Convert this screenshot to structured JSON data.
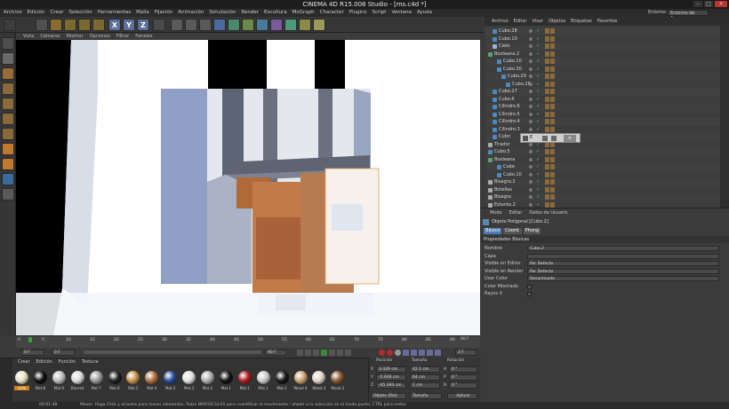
{
  "window": {
    "title": "CINEMA 4D R15.008 Studio - [ms.c4d *]",
    "layout_label": "Entorno:",
    "layout_value": "Entorno de Arranque"
  },
  "menu": [
    "Archivo",
    "Edición",
    "Crear",
    "Selección",
    "Herramientas",
    "Malla",
    "Fijación",
    "Animación",
    "Simulación",
    "Render",
    "Escultura",
    "MoGraph",
    "Character",
    "Plugins",
    "Script",
    "Ventana",
    "Ayuda"
  ],
  "toolbar": {
    "x": "X",
    "y": "Y",
    "z": "Z"
  },
  "viewport_menu": [
    "Vista",
    "Cámaras",
    "Mostrar",
    "Opciones",
    "Filtrar",
    "Paneles"
  ],
  "object_manager": {
    "menu": [
      "Archivo",
      "Editar",
      "Visor",
      "Objetos",
      "Etiquetas",
      "Favoritos"
    ],
    "rows": [
      {
        "name": "Cubo.28",
        "indent": 1
      },
      {
        "name": "Cubo.10",
        "indent": 1
      },
      {
        "name": "Cielo",
        "indent": 1
      },
      {
        "name": "Booleana.2",
        "indent": 0
      },
      {
        "name": "Cubo.10",
        "indent": 2
      },
      {
        "name": "Cubo.30",
        "indent": 2
      },
      {
        "name": "Cubo.29",
        "indent": 3
      },
      {
        "name": "Cubo.28",
        "indent": 4
      },
      {
        "name": "Cubo.27",
        "indent": 1
      },
      {
        "name": "Cubo.6",
        "indent": 1
      },
      {
        "name": "Cilindro.6",
        "indent": 1
      },
      {
        "name": "Cilindro.5",
        "indent": 1
      },
      {
        "name": "Cilindro.4",
        "indent": 1
      },
      {
        "name": "Cilindro.3",
        "indent": 1
      },
      {
        "name": "Cubo",
        "indent": 1
      },
      {
        "name": "Tirador",
        "indent": 0
      },
      {
        "name": "Cubo.5",
        "indent": 0
      },
      {
        "name": "Booleana",
        "indent": 0
      },
      {
        "name": "Cube",
        "indent": 2
      },
      {
        "name": "Cubo.10",
        "indent": 2
      },
      {
        "name": "Bisagra.2",
        "indent": 0
      },
      {
        "name": "Botellas",
        "indent": 0
      },
      {
        "name": "Bisagra",
        "indent": 0
      },
      {
        "name": "Estante.2",
        "indent": 0
      }
    ],
    "popup_label": "E"
  },
  "attributes": {
    "menu": [
      "Modo",
      "Editar",
      "Datos de Usuario"
    ],
    "object_title": "Objeto Poligonal [Cubo.2]",
    "tabs": [
      "Básico",
      "Coord.",
      "Phong"
    ],
    "section": "Propiedades Básicas",
    "rows": [
      {
        "label": "Nombre",
        "value": "Cubo.2"
      },
      {
        "label": "Capa",
        "value": ""
      },
      {
        "label": "Visible en Editor",
        "value": "Por Defecto"
      },
      {
        "label": "Visible en Render",
        "value": "Por Defecto"
      },
      {
        "label": "Usar Color",
        "value": "Desactivado"
      },
      {
        "label": "Color Mostrado",
        "value": ""
      },
      {
        "label": "Rayos X",
        "value": ""
      }
    ]
  },
  "timeline": {
    "ticks": [
      "0",
      "5",
      "10",
      "15",
      "20",
      "25",
      "30",
      "35",
      "40",
      "45",
      "50",
      "55",
      "60",
      "65",
      "70",
      "75",
      "80",
      "85",
      "90"
    ],
    "frame_start": "0 F",
    "frame_current": "0 F",
    "frame_end": "90 F",
    "frame_end_right": "90 F",
    "frame_field": "2 F"
  },
  "materials": {
    "menu": [
      "Crear",
      "Edición",
      "Función",
      "Textura"
    ],
    "items": [
      {
        "label": "cielo",
        "color": "#e8e0c0",
        "selected": true
      },
      {
        "label": "Mat.8",
        "color": "#111111"
      },
      {
        "label": "Mat.9",
        "color": "#bbbbbb"
      },
      {
        "label": "Blurred",
        "color": "#d8d8d8"
      },
      {
        "label": "Mat.7",
        "color": "#9a9a9a"
      },
      {
        "label": "Mat.6",
        "color": "#202020"
      },
      {
        "label": "Mat.5",
        "color": "#c8924a"
      },
      {
        "label": "Mat.4",
        "color": "#b07040"
      },
      {
        "label": "Mat.3",
        "color": "#2a4a9a"
      },
      {
        "label": "Mat.3",
        "color": "#e0e0e0"
      },
      {
        "label": "Mat.2",
        "color": "#b0b0b0"
      },
      {
        "label": "Mat.1",
        "color": "#151515"
      },
      {
        "label": "Mat.1",
        "color": "#aa2020"
      },
      {
        "label": "Mat.1",
        "color": "#c8c8c8"
      },
      {
        "label": "Mat.1",
        "color": "#181818"
      },
      {
        "label": "Wood 4",
        "color": "#c8a070"
      },
      {
        "label": "Wood 3",
        "color": "#ddd6c8"
      },
      {
        "label": "Wood 2",
        "color": "#8a5a30"
      }
    ]
  },
  "coords": {
    "headers": [
      "Posición",
      "Tamaño",
      "Rotación"
    ],
    "rows": [
      {
        "axis": "X",
        "pos": "3.329 cm",
        "size": "42.1 cm",
        "rot_axis": "H",
        "rot": "0 °"
      },
      {
        "axis": "Y",
        "pos": "-5.928 cm",
        "size": "64 cm",
        "rot_axis": "P",
        "rot": "0 °"
      },
      {
        "axis": "Z",
        "pos": "-45.393 cm",
        "size": "1 cm",
        "rot_axis": "B",
        "rot": "0 °"
      }
    ],
    "mode_select": "Objeto (Rel)",
    "size_select": "Tamaño",
    "apply": "Aplicar"
  },
  "status": {
    "time": "00:01:48",
    "message": "Mover: Haga Click y arrastre para mover elementos. Pulse MAYÚSCULAS para cuantificar el movimiento / añadir a la selección en el modo punto; CTRL para restar."
  },
  "colors": {
    "accent": "#5b6f9a",
    "dark": "#2b2b2b",
    "panel": "#3d3d3d"
  }
}
